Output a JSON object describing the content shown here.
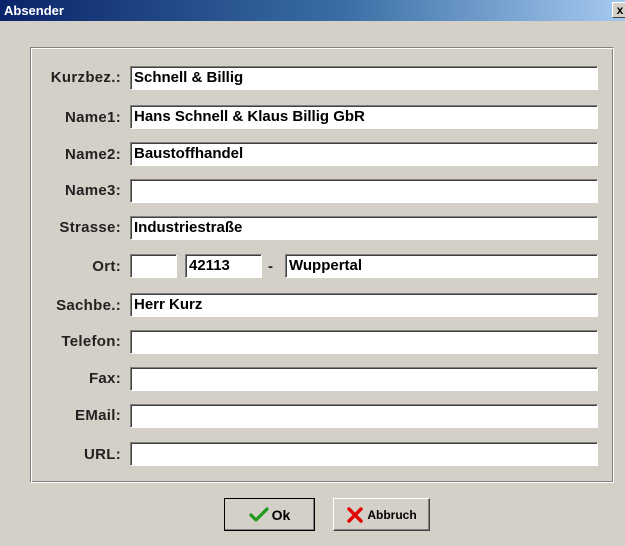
{
  "window": {
    "title": "Absender",
    "close_glyph": "x"
  },
  "form": {
    "kurzbez": {
      "label": "Kurzbez.:",
      "value": "Schnell & Billig"
    },
    "name1": {
      "label": "Name1:",
      "value": "Hans Schnell & Klaus Billig GbR"
    },
    "name2": {
      "label": "Name2:",
      "value": "Baustoffhandel"
    },
    "name3": {
      "label": "Name3:",
      "value": ""
    },
    "strasse": {
      "label": "Strasse:",
      "value": "Industriestraße"
    },
    "ort": {
      "label": "Ort:",
      "country": "",
      "plz": "42113",
      "separator": "-",
      "city": "Wuppertal"
    },
    "sachbe": {
      "label": "Sachbe.:",
      "value": "Herr Kurz"
    },
    "telefon": {
      "label": "Telefon:",
      "value": ""
    },
    "fax": {
      "label": "Fax:",
      "value": ""
    },
    "email": {
      "label": "EMail:",
      "value": ""
    },
    "url": {
      "label": "URL:",
      "value": ""
    }
  },
  "buttons": {
    "ok": {
      "label": "Ok",
      "icon": "checkmark-icon",
      "icon_color": "#1f9a1f"
    },
    "cancel": {
      "label": "Abbruch",
      "icon": "red-x-icon",
      "icon_color": "#e00000"
    }
  }
}
